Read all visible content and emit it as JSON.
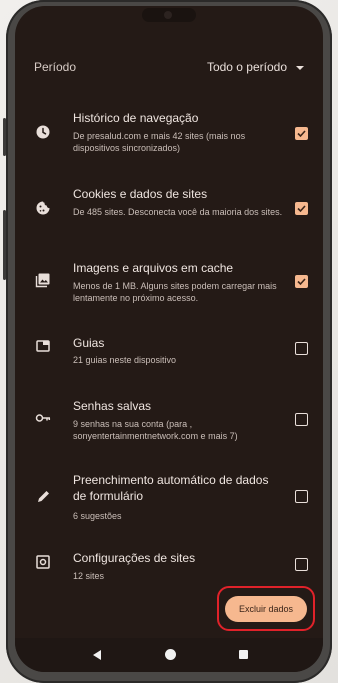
{
  "period": {
    "label": "Período",
    "value": "Todo o período"
  },
  "items": [
    {
      "title": "Histórico de navegação",
      "desc": "De presalud.com e mais 42 sites (mais nos dispositivos sincronizados)",
      "icon": "clock-icon",
      "checked": true
    },
    {
      "title": "Cookies e dados de sites",
      "desc": "De 485 sites. Desconecta você da maioria dos sites.",
      "icon": "cookie-icon",
      "checked": true
    },
    {
      "title": "Imagens e arquivos em cache",
      "desc": "Menos de 1 MB. Alguns sites podem carregar mais lentamente no próximo acesso.",
      "icon": "image-icon",
      "checked": true
    },
    {
      "title": "Guias",
      "desc": "21 guias neste dispositivo",
      "icon": "tab-icon",
      "checked": false
    },
    {
      "title": "Senhas salvas",
      "desc": "9 senhas na sua conta (para , sonyentertainmentnetwork.com e mais 7)",
      "icon": "key-icon",
      "checked": false
    },
    {
      "title": "Preenchimento automático de dados de formulário",
      "desc": "6 sugestões",
      "icon": "pencil-icon",
      "checked": false
    },
    {
      "title": "Configurações de sites",
      "desc": "12 sites",
      "icon": "settings-icon",
      "checked": false
    }
  ],
  "delete_button": "Excluir dados",
  "colors": {
    "background": "#241a16",
    "accent": "#f6b88f",
    "highlight": "#e0222a"
  }
}
